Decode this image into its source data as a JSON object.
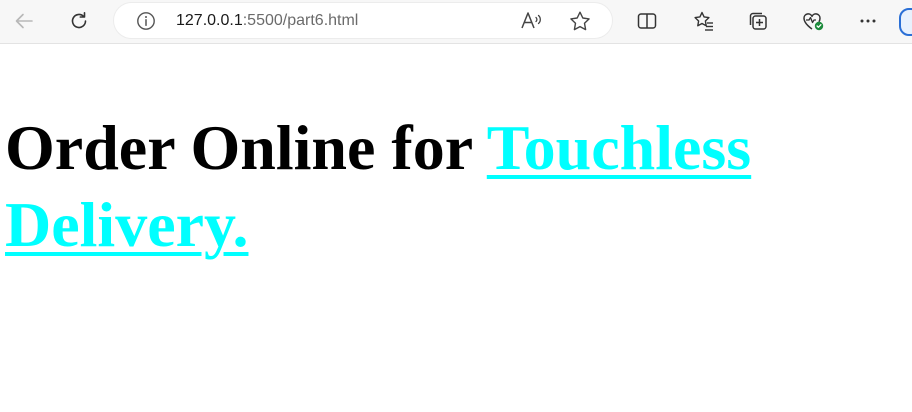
{
  "browser": {
    "url_host": "127.0.0.1",
    "url_rest": ":5500/part6.html",
    "icons": {
      "back": "back-arrow-icon",
      "reload": "reload-icon",
      "info": "info-icon",
      "read_aloud": "read-aloud-icon",
      "favorite": "favorite-star-icon",
      "split_screen": "split-screen-icon",
      "favorites": "favorites-icon",
      "collections": "collections-icon",
      "browser_essentials": "browser-essentials-icon",
      "more": "more-icon"
    }
  },
  "page": {
    "heading_text": "Order Online for ",
    "link_text": "Touchless Delivery.",
    "link_color": "#00ffff"
  }
}
